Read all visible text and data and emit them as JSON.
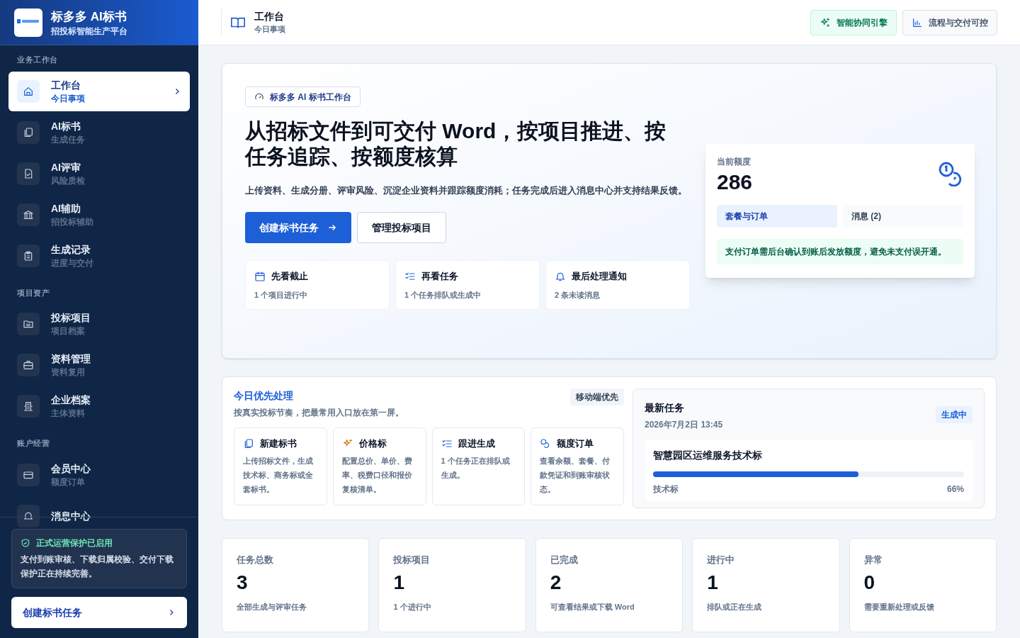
{
  "sidebar": {
    "brand": {
      "title": "标多多 AI标书",
      "subtitle": "招投标智能生产平台"
    },
    "sections": [
      {
        "label": "业务工作台",
        "items": [
          {
            "title": "工作台",
            "subtitle": "今日事项",
            "selected": true
          },
          {
            "title": "AI标书",
            "subtitle": "生成任务",
            "selected": false
          },
          {
            "title": "AI评审",
            "subtitle": "风险质检",
            "selected": false
          },
          {
            "title": "AI辅助",
            "subtitle": "招投标辅助",
            "selected": false
          },
          {
            "title": "生成记录",
            "subtitle": "进度与交付",
            "selected": false
          }
        ]
      },
      {
        "label": "项目资产",
        "items": [
          {
            "title": "投标项目",
            "subtitle": "项目档案",
            "selected": false
          },
          {
            "title": "资料管理",
            "subtitle": "资料复用",
            "selected": false
          },
          {
            "title": "企业档案",
            "subtitle": "主体资料",
            "selected": false
          }
        ]
      },
      {
        "label": "账户经营",
        "items": [
          {
            "title": "会员中心",
            "subtitle": "额度订单",
            "selected": false
          },
          {
            "title": "消息中心",
            "selected": false
          }
        ]
      }
    ],
    "notice": {
      "title": "正式运营保护已启用",
      "text": "支付到账审核、下载归属校验、交付下载保护正在持续完善。"
    },
    "cta": "创建标书任务"
  },
  "topbar": {
    "title": "工作台",
    "subtitle": "今日事项",
    "buttons": [
      "智能协同引擎",
      "流程与交付可控"
    ]
  },
  "hero": {
    "badge": "标多多 AI 标书工作台",
    "heading": "从招标文件到可交付 Word，按项目推进、按任务追踪、按额度核算",
    "text": "上传资料、生成分册、评审风险、沉淀企业资料并跟踪额度消耗；任务完成后进入消息中心并支持结果反馈。",
    "primary": "创建标书任务",
    "secondary": "管理投标项目",
    "steps": [
      {
        "title": "先看截止",
        "text": "1 个项目进行中"
      },
      {
        "title": "再看任务",
        "text": "1 个任务排队或生成中"
      },
      {
        "title": "最后处理通知",
        "text": "2 条未读消息"
      }
    ]
  },
  "quota": {
    "label": "当前额度",
    "value": "286",
    "tabs": [
      {
        "label": "套餐与订单",
        "selected": true
      },
      {
        "label": "消息 (2)",
        "selected": false
      }
    ],
    "note": "支付订单需后台确认到账后发放额度，避免未支付误开通。"
  },
  "priority": {
    "title": "今日优先处理",
    "subtitle": "按真实投标节奏，把最常用入口放在第一屏。",
    "tag": "移动端优先",
    "cards": [
      {
        "title": "新建标书",
        "text": "上传招标文件，生成技术标、商务标或全套标书。"
      },
      {
        "title": "价格标",
        "text": "配置总价、单价、费率、税费口径和报价复核清单。"
      },
      {
        "title": "跟进生成",
        "text": "1 个任务正在排队或生成。"
      },
      {
        "title": "额度订单",
        "text": "查看余额、套餐、付款凭证和到账审核状态。"
      }
    ]
  },
  "latest": {
    "title": "最新任务",
    "time": "2026年7月2日 13:45",
    "status": "生成中",
    "task": "智慧园区运维服务技术标",
    "level": 0.66,
    "type": "技术标",
    "percent": "66%"
  },
  "stats": [
    {
      "label": "任务总数",
      "value": "3",
      "text": "全部生成与评审任务"
    },
    {
      "label": "投标项目",
      "value": "1",
      "text": "1 个进行中"
    },
    {
      "label": "已完成",
      "value": "2",
      "text": "可查看结果或下载 Word"
    },
    {
      "label": "进行中",
      "value": "1",
      "text": "排队或正在生成"
    },
    {
      "label": "异常",
      "value": "0",
      "text": "需要重新处理或反馈"
    }
  ]
}
